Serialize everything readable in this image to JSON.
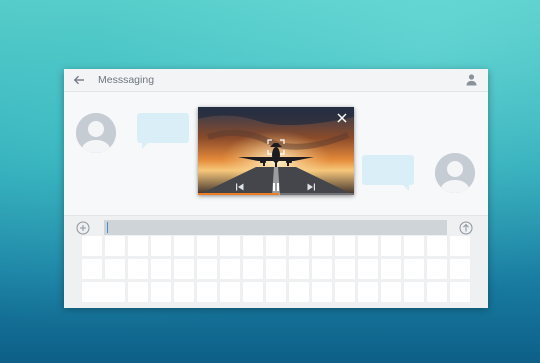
{
  "window": {
    "title": "Messsaging"
  },
  "icons": {
    "back": "arrow-left-icon",
    "account": "person-icon",
    "close": "close-icon",
    "previous": "skip-previous-icon",
    "pause": "pause-icon",
    "next": "skip-next-icon",
    "add": "plus-circle-icon",
    "send": "arrow-up-circle-icon",
    "focus": "focus-frame-icon"
  },
  "video": {
    "progress": 0.52
  },
  "composer": {
    "input_value": "",
    "input_placeholder": ""
  },
  "colors": {
    "accent": "#ef7d22",
    "bubble": "#d9eef7",
    "avatar": "#c6ccd4"
  }
}
